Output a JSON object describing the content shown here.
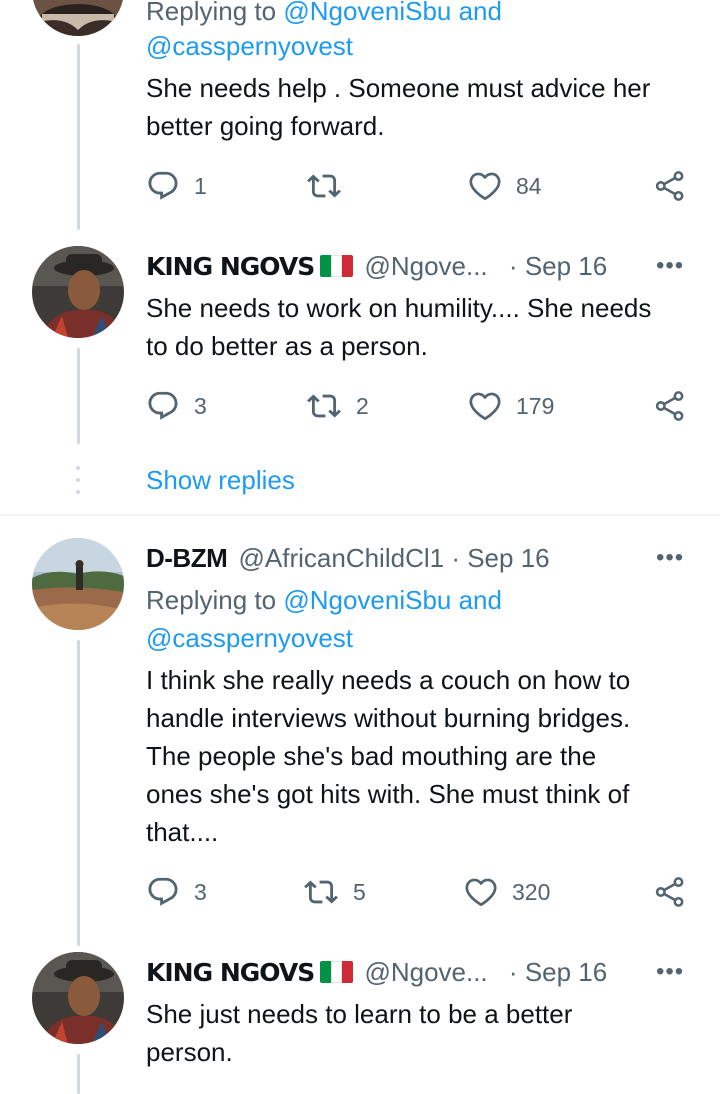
{
  "tweets": [
    {
      "reply_prefix": "Replying to ",
      "reply_handle1": "@NgoveniSbu",
      "reply_and": " and",
      "reply_handle2": "@casspernyovest",
      "text_lines": [
        "She needs help . Someone must advice her",
        "better going forward."
      ],
      "replies": "1",
      "retweets": "",
      "likes": "84"
    },
    {
      "name": "KING NGOVS",
      "handle": "@Ngove...",
      "dot": "·",
      "date": "Sep 16",
      "text_lines": [
        "She needs to work on humility.... She needs",
        "to do better as a person."
      ],
      "replies": "3",
      "retweets": "2",
      "likes": "179"
    },
    {
      "name": "D-BZM",
      "handle": "@AfricanChildCl1",
      "dot": "·",
      "date": "Sep 16",
      "reply_prefix": "Replying to ",
      "reply_handle1": "@NgoveniSbu",
      "reply_and": " and",
      "reply_handle2": "@casspernyovest",
      "text_lines": [
        "I think she really needs a couch on how to",
        "handle interviews without burning bridges.",
        "The people she's bad mouthing are the",
        "ones she's got hits with. She must think of",
        "that...."
      ],
      "replies": "3",
      "retweets": "5",
      "likes": "320"
    },
    {
      "name": "KING NGOVS",
      "handle": "@Ngove...",
      "dot": "·",
      "date": "Sep 16",
      "text_lines": [
        "She just needs to learn to be a better",
        "person."
      ]
    }
  ],
  "show_replies": "Show replies",
  "more_label": "•••",
  "icons": {
    "reply": "reply-icon",
    "retweet": "retweet-icon",
    "like": "heart-icon",
    "share": "share-icon",
    "more": "more-icon"
  },
  "colors": {
    "link": "#1d9bf0",
    "secondary": "#536471",
    "thread_line": "#cfd9de",
    "text": "#0f1419"
  }
}
